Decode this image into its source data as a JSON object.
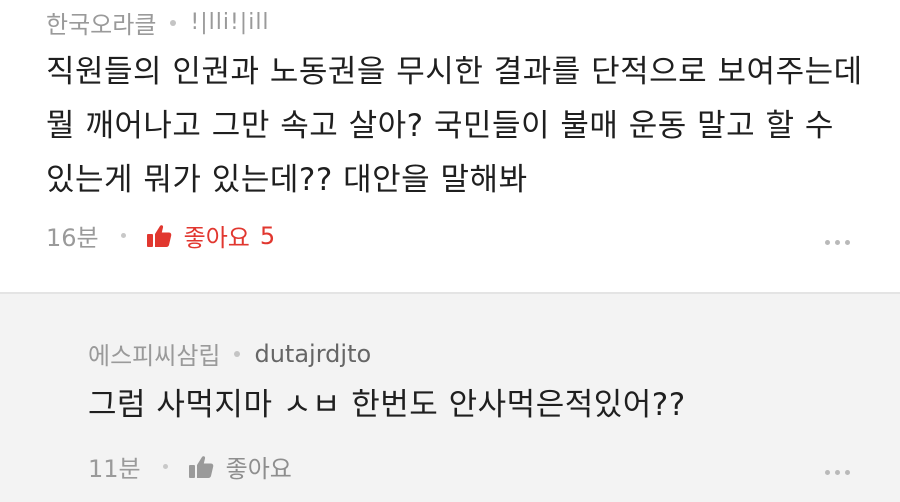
{
  "comments": [
    {
      "author": "한국오라클",
      "user_id": "!|lli!|ill",
      "lines": [
        "직원들의 인권과 노동권을 무시한 결과를 단적으로 보여주는데",
        "뭘 깨어나고 그만 속고 살아? 국민들이 불매 운동 말고 할 수",
        "있는게 뭐가 있는데?? 대안을 말해봐"
      ],
      "time": "16분",
      "like_label": "좋아요",
      "like_count": "5",
      "like_color": "#e1372f",
      "more_icon": "more-horizontal-icon"
    },
    {
      "author": "에스피씨삼립",
      "user_id": "dutajrdjto",
      "lines": [
        "그럼 사먹지마 ㅅㅂ 한번도 안사먹은적있어??"
      ],
      "time": "11분",
      "like_label": "좋아요",
      "like_color": "#8e8e8e",
      "more_icon": "more-horizontal-icon"
    }
  ]
}
